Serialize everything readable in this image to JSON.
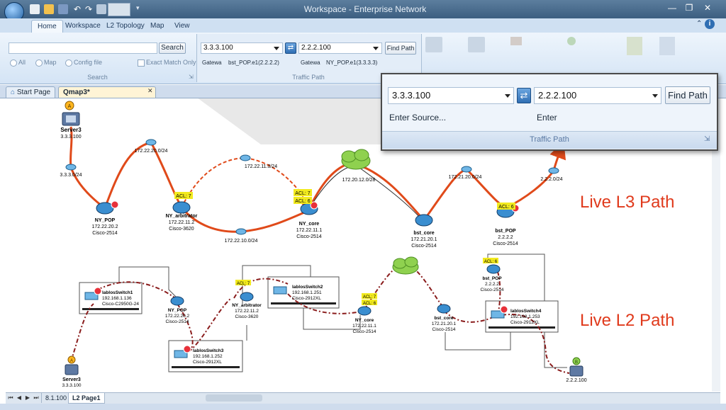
{
  "window": {
    "title": "Workspace - Enterprise Network"
  },
  "ribbon": {
    "tabs": [
      {
        "label": "Home",
        "active": true
      },
      {
        "label": "Workspace"
      },
      {
        "label": "L2 Topology"
      },
      {
        "label": "Map"
      },
      {
        "label": "View"
      }
    ],
    "search": {
      "button": "Search",
      "group_label": "Search",
      "options": [
        "All",
        "Map",
        "Config file"
      ],
      "exact_match": "Exact Match Only"
    },
    "traffic_path": {
      "source": "3.3.3.100",
      "destination": "2.2.2.100",
      "find_button": "Find Path",
      "gateway_label": "Gatewa",
      "source_gateway": "bst_POP.e1(2.2.2.2)",
      "dest_gateway": "NY_POP.e1(3.3.3.3)",
      "group_label": "Traffic Path"
    }
  },
  "doc_tabs": [
    {
      "label": "Start Page"
    },
    {
      "label": "Qmap3*",
      "active": true
    }
  ],
  "popup": {
    "source": "3.3.3.100",
    "destination": "2.2.2.100",
    "find_button": "Find Path",
    "source_hint": "Enter Source...",
    "dest_hint": "Enter",
    "group_label": "Traffic Path"
  },
  "labels": {
    "l3": "Live L3 Path",
    "l2": "Live L2 Path"
  },
  "l3": {
    "server": {
      "name": "Server3",
      "ip": "3.3.3.100",
      "badge": "A"
    },
    "devices": [
      {
        "name": "NY_POP",
        "ip": "172.22.20.2",
        "model": "Cisco-2514"
      },
      {
        "name": "NY_arbitrator",
        "ip": "172.22.11.2",
        "model": "Cisco-3620"
      },
      {
        "name": "NY_core",
        "ip": "172.22.11.1",
        "model": "Cisco-2514"
      },
      {
        "name": "bst_core",
        "ip": "172.21.20.1",
        "model": "Cisco-2514"
      },
      {
        "name": "bst_POP",
        "ip": "2.2.2.2",
        "model": "Cisco-2514"
      }
    ],
    "subnets": [
      "3.3.3.0/24",
      "172.22.20.0/24",
      "172.22.11.0/24",
      "172.22.10.0/24",
      "172.20.12.0/28",
      "172.21.20.0/24",
      "2.2.2.0/24"
    ],
    "acl": [
      "ACL: 7",
      "ACL: 7",
      "ACL: 6",
      "ACL: 6"
    ]
  },
  "l2": {
    "switches": [
      {
        "name": "lablosSwitch1",
        "ip": "192.168.1.136",
        "model": "Cisco-C2950G-24"
      },
      {
        "name": "lablosSwitch2",
        "ip": "192.168.1.251",
        "model": "Cisco-2912XL"
      },
      {
        "name": "lablosSwitch3",
        "ip": "192.168.1.252",
        "model": "Cisco-2912XL"
      },
      {
        "name": "lablosSwitch4",
        "ip": "192.168.1.253",
        "model": "Cisco-2912XL"
      }
    ],
    "routers": [
      {
        "name": "NY_POP",
        "ip": "172.22.20.2",
        "model": "Cisco-2514"
      },
      {
        "name": "NY_arbitrator",
        "ip": "172.22.11.2",
        "model": "Cisco-3620"
      },
      {
        "name": "NY_core",
        "ip": "172.22.11.1",
        "model": "Cisco-2514"
      },
      {
        "name": "bst_core",
        "ip": "172.21.20.1",
        "model": "Cisco-2514"
      },
      {
        "name": "bst_POP",
        "ip": "2.2.2.2",
        "model": "Cisco-2514"
      }
    ],
    "server": {
      "name": "Server3",
      "ip": "3.3.3.100",
      "badge": "A"
    },
    "dest": {
      "ip": "2.2.2.100",
      "badge": "B"
    },
    "acl": [
      "ACL: 7",
      "ACL: 7",
      "ACL: 6",
      "ACL: 6"
    ]
  },
  "pages": {
    "first": "8.1.100",
    "current": "L2 Page1"
  },
  "colors": {
    "accent": "#2f6eb3",
    "path_red": "#e04a1a",
    "path_dark": "#8a1c1c",
    "acl_yellow": "#f2ea1e",
    "label_red": "#e03a1c"
  }
}
